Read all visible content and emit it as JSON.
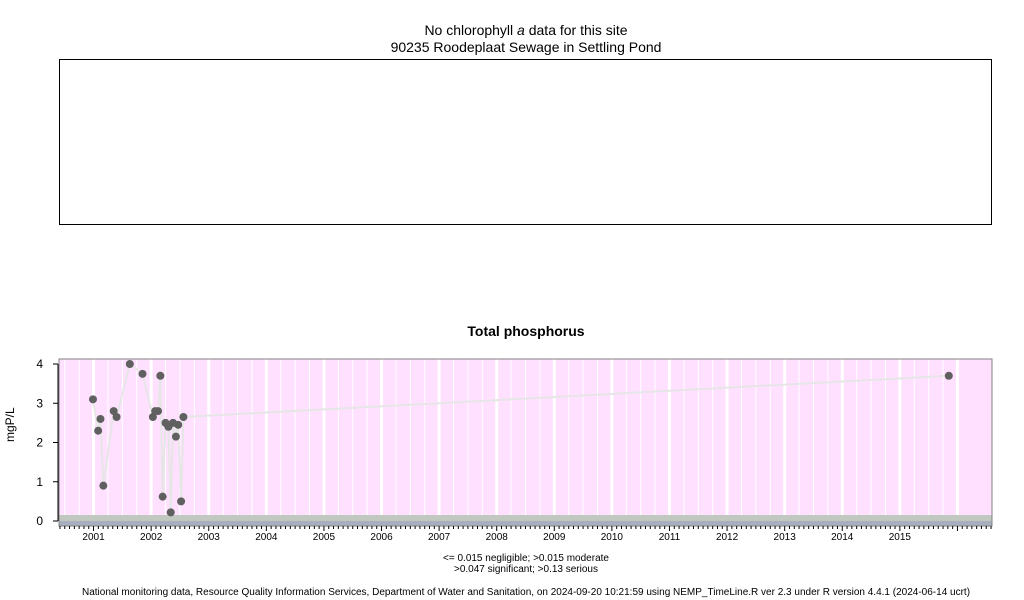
{
  "chlorophyll": {
    "title_line1_prefix": "No chlorophyll",
    "title_line1_italic": "a",
    "title_line1_suffix": "data for this site",
    "title_line2": "90235 Roodeplaat Sewage in Settling Pond"
  },
  "threshold_note": {
    "line1": "<= 0.015 negligible; >0.015 moderate",
    "line2": ">0.047 significant; >0.13 serious"
  },
  "footer": "National monitoring data, Resource Quality Information Services, Department of Water and Sanitation, on 2024-09-20 10:21:59 using NEMP_TimeLine.R ver 2.3 under R version 4.4.1 (2024-06-14 ucrt)",
  "colors": {
    "plot_background": "#ffe0ff",
    "grid": "#ffffff",
    "point": "#606060",
    "trend_line": "#e6e6e6",
    "bottom_band": "#c0c8c0",
    "axis_strip": "#a8b0c0"
  },
  "chart_data": {
    "type": "scatter",
    "title": "Total phosphorus",
    "xlabel": "",
    "ylabel": "mgP/L",
    "ylim": [
      0,
      4
    ],
    "yticks": [
      0,
      1,
      2,
      3,
      4
    ],
    "xlim": [
      2000.4,
      2016.6
    ],
    "xticks": [
      "2001",
      "2002",
      "2003",
      "2004",
      "2005",
      "2006",
      "2007",
      "2008",
      "2009",
      "2010",
      "2011",
      "2012",
      "2013",
      "2014",
      "2015"
    ],
    "grid": true,
    "series": [
      {
        "x": [
          2000.99,
          2001.08,
          2001.12,
          2001.17,
          2001.35,
          2001.4,
          2001.63,
          2001.85,
          2002.03,
          2002.07,
          2002.12,
          2002.16,
          2002.2,
          2002.25,
          2002.3,
          2002.34,
          2002.38,
          2002.43,
          2002.47,
          2002.52,
          2002.56,
          2015.85
        ],
        "y": [
          3.1,
          2.3,
          2.6,
          0.9,
          2.8,
          2.65,
          4.0,
          3.75,
          2.65,
          2.8,
          2.8,
          3.7,
          0.62,
          2.5,
          2.4,
          0.22,
          2.5,
          2.15,
          2.45,
          0.5,
          2.65,
          3.7
        ]
      }
    ]
  }
}
